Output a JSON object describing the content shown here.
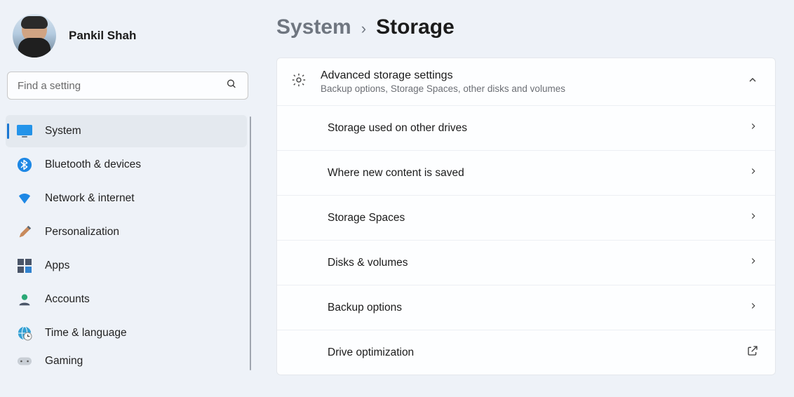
{
  "user": {
    "name": "Pankil Shah"
  },
  "search": {
    "placeholder": "Find a setting"
  },
  "sidebar": {
    "items": [
      {
        "label": "System"
      },
      {
        "label": "Bluetooth & devices"
      },
      {
        "label": "Network & internet"
      },
      {
        "label": "Personalization"
      },
      {
        "label": "Apps"
      },
      {
        "label": "Accounts"
      },
      {
        "label": "Time & language"
      },
      {
        "label": "Gaming"
      }
    ]
  },
  "breadcrumb": {
    "parent": "System",
    "sep": "›",
    "current": "Storage"
  },
  "panel": {
    "header": {
      "title": "Advanced storage settings",
      "subtitle": "Backup options, Storage Spaces, other disks and volumes"
    },
    "rows": [
      {
        "label": "Storage used on other drives",
        "action": "chevron"
      },
      {
        "label": "Where new content is saved",
        "action": "chevron"
      },
      {
        "label": "Storage Spaces",
        "action": "chevron"
      },
      {
        "label": "Disks & volumes",
        "action": "chevron"
      },
      {
        "label": "Backup options",
        "action": "chevron"
      },
      {
        "label": "Drive optimization",
        "action": "external"
      }
    ]
  }
}
